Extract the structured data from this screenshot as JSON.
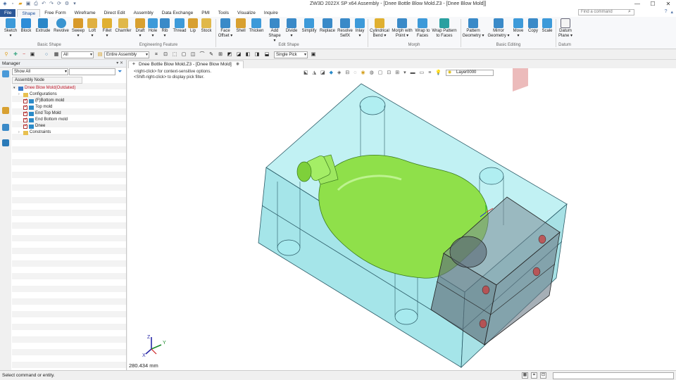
{
  "window": {
    "title": "ZW3D 2022X SP x64      Assembly - [Dnee Bottle Blow Mold.Z3 - [Dnee Blow Mold]]"
  },
  "ribbon_tabs": [
    "File",
    "Shape",
    "Free Form",
    "Wireframe",
    "Direct Edit",
    "Assembly",
    "Data Exchange",
    "PMI",
    "Tools",
    "Visualize",
    "Inquire"
  ],
  "search": {
    "placeholder": "Find a command"
  },
  "ribbon": {
    "buttons": [
      {
        "label": "Sketch",
        "sub": "▾"
      },
      {
        "label": "Block",
        "sub": ""
      },
      {
        "label": "Extrude",
        "sub": ""
      },
      {
        "label": "Revolve",
        "sub": ""
      },
      {
        "label": "Sweep",
        "sub": "▾"
      },
      {
        "label": "Loft",
        "sub": "▾"
      },
      {
        "label": "Fillet",
        "sub": "▾"
      },
      {
        "label": "Chamfer",
        "sub": ""
      },
      {
        "label": "Draft",
        "sub": "▾"
      },
      {
        "label": "Hole",
        "sub": "▾"
      },
      {
        "label": "Rib",
        "sub": "▾"
      },
      {
        "label": "Thread",
        "sub": ""
      },
      {
        "label": "Lip",
        "sub": ""
      },
      {
        "label": "Stock",
        "sub": ""
      },
      {
        "label": "Face",
        "sub": "Offset ▾"
      },
      {
        "label": "Shell",
        "sub": ""
      },
      {
        "label": "Thicken",
        "sub": ""
      },
      {
        "label": "Add",
        "sub": "Shape ▾"
      },
      {
        "label": "Divide",
        "sub": "▾"
      },
      {
        "label": "Simplify",
        "sub": ""
      },
      {
        "label": "Replace",
        "sub": ""
      },
      {
        "label": "Resolve",
        "sub": "SelfX"
      },
      {
        "label": "Inlay",
        "sub": "▾"
      },
      {
        "label": "Cylindrical",
        "sub": "Bend ▾"
      },
      {
        "label": "Morph with",
        "sub": "Point ▾"
      },
      {
        "label": "Wrap to",
        "sub": "Faces"
      },
      {
        "label": "Wrap Pattern",
        "sub": "to Faces"
      },
      {
        "label": "Pattern",
        "sub": "Geometry ▾"
      },
      {
        "label": "Mirror",
        "sub": "Geometry ▾"
      },
      {
        "label": "Move",
        "sub": "▾"
      },
      {
        "label": "Copy",
        "sub": ""
      },
      {
        "label": "Scale",
        "sub": ""
      },
      {
        "label": "Datum",
        "sub": "Plane ▾"
      }
    ],
    "groups": [
      "Basic Shape",
      "Engineering Feature",
      "Edit Shape",
      "Morph",
      "Basic Editing",
      "Datum"
    ]
  },
  "toolbar": {
    "filter_value": "All",
    "scope_value": "Entire Assembly",
    "pick_value": "Single Pick"
  },
  "manager": {
    "title": "Manager",
    "show_filter": "Show All",
    "column_header": "Assembly Node",
    "nodes": [
      {
        "label": "Dnee Blow Mold(Outdated)"
      },
      {
        "label": "Configurations"
      },
      {
        "label": "(F)Bottom mold"
      },
      {
        "label": "Top mold"
      },
      {
        "label": "End Top Mold"
      },
      {
        "label": "End Bottom mold"
      },
      {
        "label": "Dnee"
      },
      {
        "label": "Constraints"
      }
    ]
  },
  "document_tab": "Dnee Bottle Blow Mold.Z3 - [Dnee Blow Mold]",
  "viewport": {
    "hint1": "<right-click> for context-sensitive options.",
    "hint2": "<Shift-right-click> to display pick filter.",
    "layer": "Layer0000",
    "distance": "280.434 mm"
  },
  "status": {
    "message": "Select command or entity."
  },
  "colors": {
    "file_tab": "#2b5797",
    "mold_fill": "#7fe0e4",
    "bottle_fill": "#8fe04a",
    "end_block_fill": "#6a7a88",
    "pin_red": "#c83c3c"
  }
}
